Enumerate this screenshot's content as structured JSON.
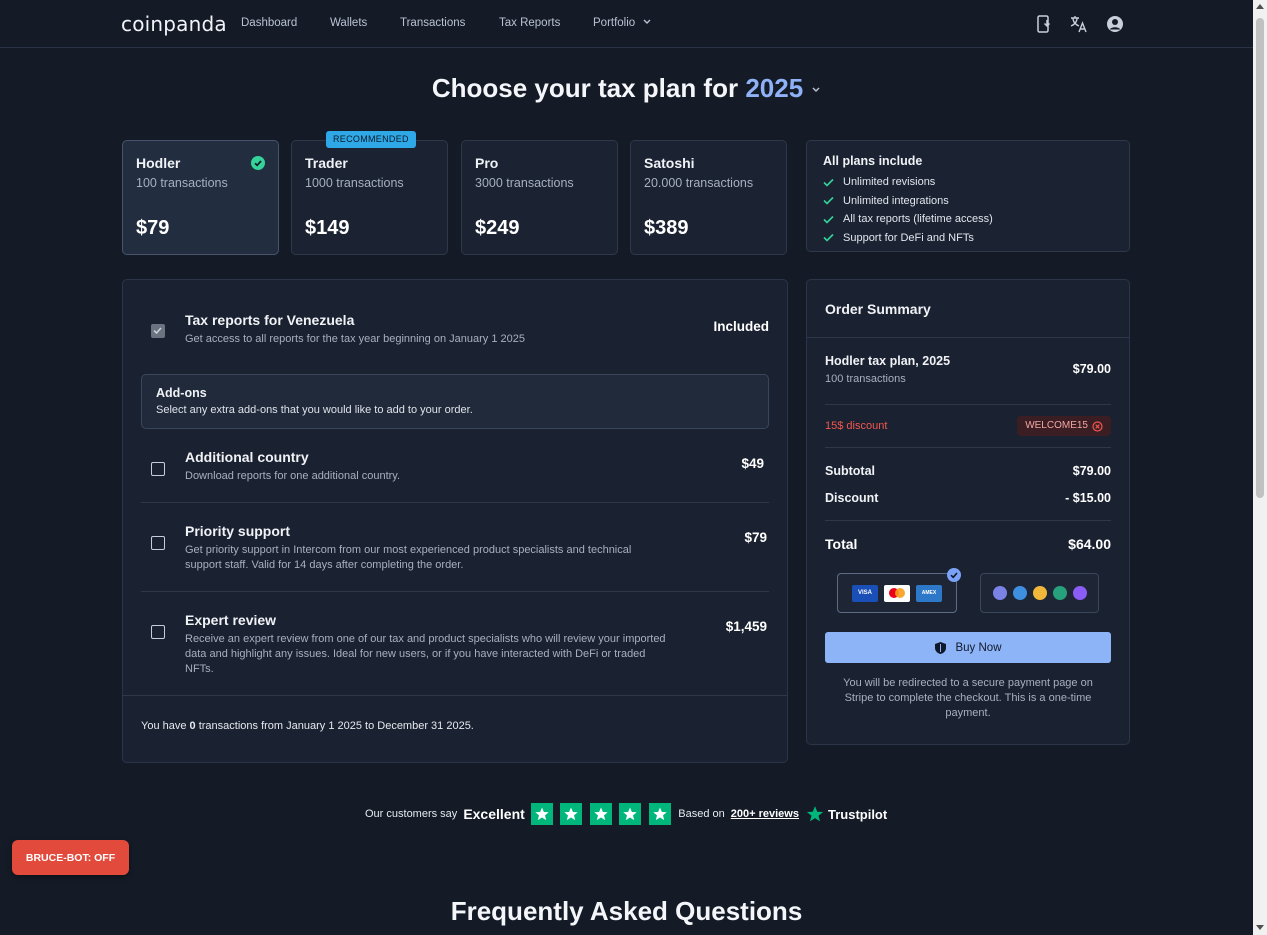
{
  "nav": {
    "logo": "coinpanda",
    "links": [
      "Dashboard",
      "Wallets",
      "Transactions",
      "Tax Reports",
      "Portfolio"
    ]
  },
  "heading": {
    "prefix": "Choose your tax plan for ",
    "year": "2025"
  },
  "plans": [
    {
      "name": "Hodler",
      "transactions": "100 transactions",
      "price": "$79",
      "selected": true
    },
    {
      "name": "Trader",
      "transactions": "1000 transactions",
      "price": "$149"
    },
    {
      "name": "Pro",
      "transactions": "3000 transactions",
      "price": "$249"
    },
    {
      "name": "Satoshi",
      "transactions": "20.000 transactions",
      "price": "$389"
    }
  ],
  "recommended_badge": "RECOMMENDED",
  "includes": {
    "title": "All plans include",
    "items": [
      "Unlimited revisions",
      "Unlimited integrations",
      "All tax reports (lifetime access)",
      "Support for DeFi and NFTs"
    ]
  },
  "main": {
    "country": {
      "title": "Tax reports for Venezuela",
      "desc": "Get access to all reports for the tax year beginning on January 1 2025",
      "price": "Included"
    },
    "addons": {
      "title": "Add-ons",
      "desc": "Select any extra add-ons that you would like to add to your order."
    },
    "items": [
      {
        "title": "Additional country",
        "desc": "Download reports for one additional country.",
        "price": "$49"
      },
      {
        "title": "Priority support",
        "desc": "Get priority support in Intercom from our most experienced product specialists and technical support staff. Valid for 14 days after completing the order.",
        "price": "$79"
      },
      {
        "title": "Expert review",
        "desc": "Receive an expert review from one of our tax and product specialists who will review your imported data and highlight any issues. Ideal for new users, or if you have interacted with DeFi or traded NFTs.",
        "price": "$1,459"
      }
    ],
    "footer": {
      "prefix": "You have ",
      "count": "0",
      "suffix": " transactions from January 1 2025 to December 31 2025."
    }
  },
  "summary": {
    "title": "Order Summary",
    "plan_label": "Hodler tax plan, 2025",
    "plan_sub": "100 transactions",
    "plan_price": "$79.00",
    "discount_label": "15$ discount",
    "coupon": "WELCOME15",
    "subtotal_label": "Subtotal",
    "subtotal": "$79.00",
    "discount_row_label": "Discount",
    "discount": "- $15.00",
    "total_label": "Total",
    "total": "$64.00",
    "cards": [
      "VISA",
      "MC",
      "AMEX"
    ],
    "buy_label": "Buy Now",
    "redirect_note": "You will be redirected to a secure payment page on Stripe to complete the checkout. This is a one-time payment."
  },
  "trust": {
    "say": "Our customers say",
    "rating": "Excellent",
    "based": "Based on",
    "link": "200+ reviews",
    "brand": "Trustpilot"
  },
  "bruce_bot": "BRUCE-BOT: OFF",
  "faq_title": "Frequently Asked Questions",
  "colors": {
    "accent": "#8eb4f8",
    "success": "#34d399",
    "danger": "#f0574f",
    "trustpilot": "#00b67a",
    "background": "#141b27"
  }
}
